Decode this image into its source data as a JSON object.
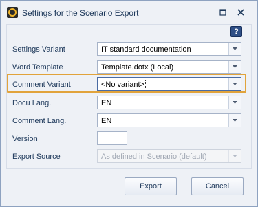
{
  "window": {
    "title": "Settings for the Scenario Export",
    "icon": "scenario-export-icon",
    "controls": [
      "restore-icon",
      "close-icon"
    ]
  },
  "help": {
    "label": "?"
  },
  "fields": {
    "settings_variant": {
      "label": "Settings Variant",
      "value": "IT standard documentation"
    },
    "word_template": {
      "label": "Word Template",
      "value": "Template.dotx (Local)"
    },
    "comment_variant": {
      "label": "Comment Variant",
      "value": "<No variant>"
    },
    "docu_lang": {
      "label": "Docu Lang.",
      "value": "EN"
    },
    "comment_lang": {
      "label": "Comment Lang.",
      "value": "EN"
    },
    "version": {
      "label": "Version",
      "value": ""
    },
    "export_source": {
      "label": "Export Source",
      "value": "As defined in Scenario (default)"
    }
  },
  "buttons": {
    "export": "Export",
    "cancel": "Cancel"
  },
  "colors": {
    "highlight": "#e1a33b",
    "window_bg": "#eef1f6",
    "text": "#1e395b"
  }
}
